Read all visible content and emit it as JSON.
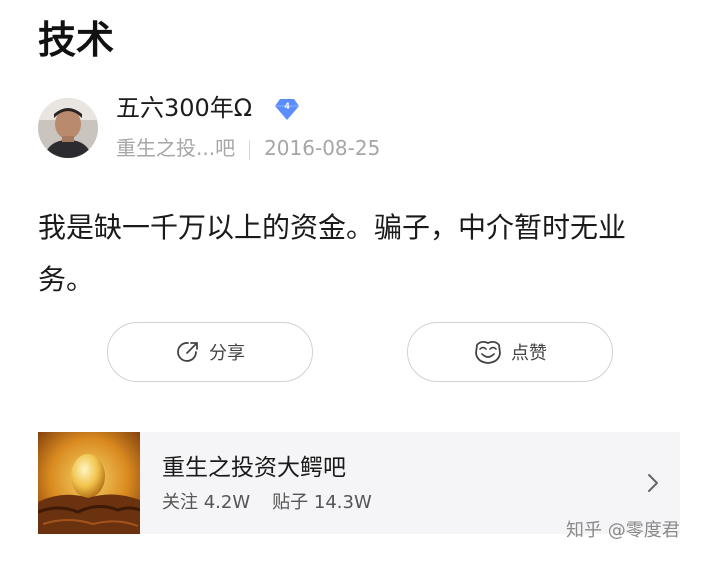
{
  "page": {
    "title": "技术"
  },
  "post": {
    "author": {
      "name": "五六300年Ω",
      "level": "4"
    },
    "forum_short": "重生之投...吧",
    "date": "2016-08-25",
    "body": "我是缺一千万以上的资金。骗子，中介暂时无业务。"
  },
  "actions": {
    "share_label": "分享",
    "like_label": "点赞"
  },
  "forum_card": {
    "name": "重生之投资大鳄吧",
    "followers_label": "关注 4.2W",
    "posts_label": "贴子 14.3W"
  },
  "watermark": "知乎 @零度君",
  "colors": {
    "badge": "#5b8dff",
    "meta_text": "#a6a6a6",
    "card_bg": "#f5f5f7"
  }
}
